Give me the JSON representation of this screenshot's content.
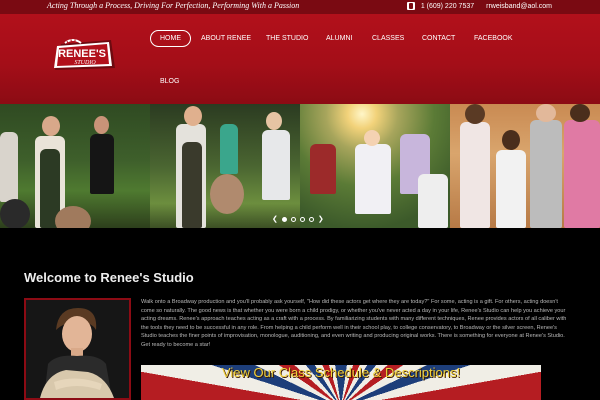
{
  "topbar": {
    "tagline": "Acting Through a Process, Driving For Perfection, Performing With a Passion",
    "phone": "1 (609) 220 7537",
    "email": "rrweisband@aol.com"
  },
  "logo": {
    "text": "RENEE'S",
    "subtext": "STUDIO"
  },
  "nav": {
    "items": [
      {
        "label": "HOME",
        "active": true
      },
      {
        "label": "ABOUT RENEE"
      },
      {
        "label": "THE STUDIO"
      },
      {
        "label": "ALUMNI"
      },
      {
        "label": "CLASSES"
      },
      {
        "label": "CONTACT"
      },
      {
        "label": "FACEBOOK"
      },
      {
        "label": "BLOG"
      }
    ]
  },
  "slider": {
    "dot_count": 4,
    "active_dot": 0
  },
  "welcome": {
    "title": "Welcome to Renee's Studio",
    "body": "Walk onto a Broadway production and you'll probably ask yourself, \"How did these actors get where they are today?\" For some, acting is a gift. For others, acting doesn't come so naturally. The good news is that whether you were born a child prodigy, or whether you've never acted a day in your life, Renee's Studio can help you achieve your acting dreams. Renee's approach teaches acting as a craft with a process. By familiarizing students with many different techniques, Renee provides actors of all caliber with the tools they need to be successful in any role. From helping a child perform well in their school play, to college conservatory, to Broadway or the silver screen, Renee's Studio teaches the finer points of improvisation, monologue, auditioning, and even writing and producing original works. There is something for everyone at Renee's Studio. Get ready to become a star!"
  },
  "schedule_banner": {
    "label": "View Our Class Schedule & Descriptions!"
  },
  "colors": {
    "brand_red": "#a40e18",
    "topbar_red": "#7a0a12",
    "banner_yellow": "#f2d23a"
  }
}
